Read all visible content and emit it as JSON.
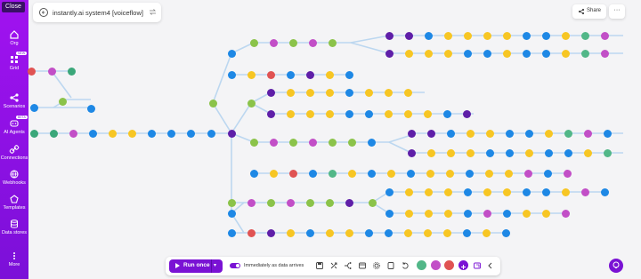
{
  "sidebar": {
    "close_label": "Close",
    "items": [
      {
        "label": "Org",
        "icon": "home-icon"
      },
      {
        "label": "Grid",
        "icon": "grid-icon",
        "badge": "NEW"
      },
      {
        "label": "Scenarios",
        "icon": "share-nodes-icon"
      },
      {
        "label": "AI Agents",
        "icon": "ai-agent-icon",
        "badge": "BETA"
      },
      {
        "label": "Connections",
        "icon": "link-icon"
      },
      {
        "label": "Webhooks",
        "icon": "globe-icon"
      },
      {
        "label": "Templates",
        "icon": "templates-icon"
      },
      {
        "label": "Data stores",
        "icon": "database-icon"
      },
      {
        "label": "More",
        "icon": "more-vertical-icon"
      }
    ]
  },
  "header": {
    "title": "instantly.ai system4 [voiceflow]",
    "share_label": "Share",
    "more_label": "···"
  },
  "toolbar": {
    "run_label": "Run once",
    "schedule_label": "Immediately as data arrives"
  },
  "colors": {
    "accent": "#7a12d4",
    "sidebar_top": "#a112f0",
    "sidebar_bottom": "#7b10d8",
    "node_blue": "#1e88e5",
    "node_yellow": "#f7c624",
    "node_purple": "#5f1fa8",
    "node_pink": "#c24fc7",
    "node_green": "#52b788",
    "node_teal": "#3ba77a",
    "node_lime": "#8bc34a",
    "node_red": "#e05353",
    "node_sky": "#2f9be6"
  }
}
